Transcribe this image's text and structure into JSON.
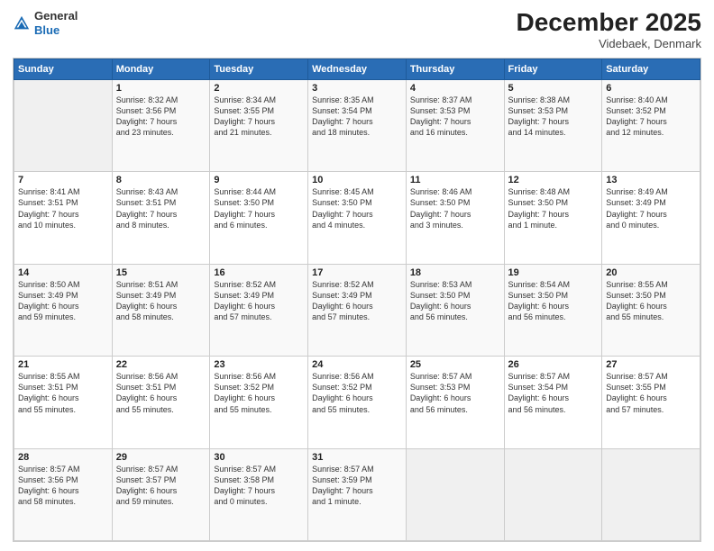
{
  "header": {
    "logo": {
      "line1": "General",
      "line2": "Blue"
    },
    "title": "December 2025",
    "location": "Videbaek, Denmark"
  },
  "weekdays": [
    "Sunday",
    "Monday",
    "Tuesday",
    "Wednesday",
    "Thursday",
    "Friday",
    "Saturday"
  ],
  "weeks": [
    [
      {
        "day": "",
        "info": ""
      },
      {
        "day": "1",
        "info": "Sunrise: 8:32 AM\nSunset: 3:56 PM\nDaylight: 7 hours\nand 23 minutes."
      },
      {
        "day": "2",
        "info": "Sunrise: 8:34 AM\nSunset: 3:55 PM\nDaylight: 7 hours\nand 21 minutes."
      },
      {
        "day": "3",
        "info": "Sunrise: 8:35 AM\nSunset: 3:54 PM\nDaylight: 7 hours\nand 18 minutes."
      },
      {
        "day": "4",
        "info": "Sunrise: 8:37 AM\nSunset: 3:53 PM\nDaylight: 7 hours\nand 16 minutes."
      },
      {
        "day": "5",
        "info": "Sunrise: 8:38 AM\nSunset: 3:53 PM\nDaylight: 7 hours\nand 14 minutes."
      },
      {
        "day": "6",
        "info": "Sunrise: 8:40 AM\nSunset: 3:52 PM\nDaylight: 7 hours\nand 12 minutes."
      }
    ],
    [
      {
        "day": "7",
        "info": "Sunrise: 8:41 AM\nSunset: 3:51 PM\nDaylight: 7 hours\nand 10 minutes."
      },
      {
        "day": "8",
        "info": "Sunrise: 8:43 AM\nSunset: 3:51 PM\nDaylight: 7 hours\nand 8 minutes."
      },
      {
        "day": "9",
        "info": "Sunrise: 8:44 AM\nSunset: 3:50 PM\nDaylight: 7 hours\nand 6 minutes."
      },
      {
        "day": "10",
        "info": "Sunrise: 8:45 AM\nSunset: 3:50 PM\nDaylight: 7 hours\nand 4 minutes."
      },
      {
        "day": "11",
        "info": "Sunrise: 8:46 AM\nSunset: 3:50 PM\nDaylight: 7 hours\nand 3 minutes."
      },
      {
        "day": "12",
        "info": "Sunrise: 8:48 AM\nSunset: 3:50 PM\nDaylight: 7 hours\nand 1 minute."
      },
      {
        "day": "13",
        "info": "Sunrise: 8:49 AM\nSunset: 3:49 PM\nDaylight: 7 hours\nand 0 minutes."
      }
    ],
    [
      {
        "day": "14",
        "info": "Sunrise: 8:50 AM\nSunset: 3:49 PM\nDaylight: 6 hours\nand 59 minutes."
      },
      {
        "day": "15",
        "info": "Sunrise: 8:51 AM\nSunset: 3:49 PM\nDaylight: 6 hours\nand 58 minutes."
      },
      {
        "day": "16",
        "info": "Sunrise: 8:52 AM\nSunset: 3:49 PM\nDaylight: 6 hours\nand 57 minutes."
      },
      {
        "day": "17",
        "info": "Sunrise: 8:52 AM\nSunset: 3:49 PM\nDaylight: 6 hours\nand 57 minutes."
      },
      {
        "day": "18",
        "info": "Sunrise: 8:53 AM\nSunset: 3:50 PM\nDaylight: 6 hours\nand 56 minutes."
      },
      {
        "day": "19",
        "info": "Sunrise: 8:54 AM\nSunset: 3:50 PM\nDaylight: 6 hours\nand 56 minutes."
      },
      {
        "day": "20",
        "info": "Sunrise: 8:55 AM\nSunset: 3:50 PM\nDaylight: 6 hours\nand 55 minutes."
      }
    ],
    [
      {
        "day": "21",
        "info": "Sunrise: 8:55 AM\nSunset: 3:51 PM\nDaylight: 6 hours\nand 55 minutes."
      },
      {
        "day": "22",
        "info": "Sunrise: 8:56 AM\nSunset: 3:51 PM\nDaylight: 6 hours\nand 55 minutes."
      },
      {
        "day": "23",
        "info": "Sunrise: 8:56 AM\nSunset: 3:52 PM\nDaylight: 6 hours\nand 55 minutes."
      },
      {
        "day": "24",
        "info": "Sunrise: 8:56 AM\nSunset: 3:52 PM\nDaylight: 6 hours\nand 55 minutes."
      },
      {
        "day": "25",
        "info": "Sunrise: 8:57 AM\nSunset: 3:53 PM\nDaylight: 6 hours\nand 56 minutes."
      },
      {
        "day": "26",
        "info": "Sunrise: 8:57 AM\nSunset: 3:54 PM\nDaylight: 6 hours\nand 56 minutes."
      },
      {
        "day": "27",
        "info": "Sunrise: 8:57 AM\nSunset: 3:55 PM\nDaylight: 6 hours\nand 57 minutes."
      }
    ],
    [
      {
        "day": "28",
        "info": "Sunrise: 8:57 AM\nSunset: 3:56 PM\nDaylight: 6 hours\nand 58 minutes."
      },
      {
        "day": "29",
        "info": "Sunrise: 8:57 AM\nSunset: 3:57 PM\nDaylight: 6 hours\nand 59 minutes."
      },
      {
        "day": "30",
        "info": "Sunrise: 8:57 AM\nSunset: 3:58 PM\nDaylight: 7 hours\nand 0 minutes."
      },
      {
        "day": "31",
        "info": "Sunrise: 8:57 AM\nSunset: 3:59 PM\nDaylight: 7 hours\nand 1 minute."
      },
      {
        "day": "",
        "info": ""
      },
      {
        "day": "",
        "info": ""
      },
      {
        "day": "",
        "info": ""
      }
    ]
  ]
}
